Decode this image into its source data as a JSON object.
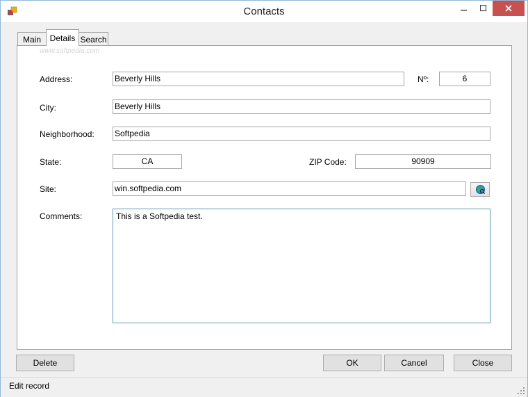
{
  "window": {
    "title": "Contacts"
  },
  "tabs": [
    {
      "label": "Main"
    },
    {
      "label": "Details"
    },
    {
      "label": "Search"
    }
  ],
  "watermark": "www.softpedia.com",
  "form": {
    "address_label": "Address:",
    "address_value": "Beverly Hills",
    "number_label": "Nº:",
    "number_value": "6",
    "city_label": "City:",
    "city_value": "Beverly Hills",
    "neighborhood_label": "Neighborhood:",
    "neighborhood_value": "Softpedia",
    "state_label": "State:",
    "state_value": "CA",
    "zip_label": "ZIP Code:",
    "zip_value": "90909",
    "site_label": "Site:",
    "site_value": "win.softpedia.com",
    "comments_label": "Comments:",
    "comments_value": "This is a Softpedia test."
  },
  "buttons": {
    "delete": "Delete",
    "ok": "OK",
    "cancel": "Cancel",
    "close": "Close"
  },
  "status": {
    "text": "Edit record"
  },
  "icons": {
    "app": "app-icon",
    "browse": "globe-icon",
    "minimize": "minimize-icon",
    "maximize": "maximize-icon",
    "close": "close-icon"
  },
  "colors": {
    "close_button": "#c75050",
    "memo_border": "#5a9ab8",
    "window_border": "#8fb7db"
  }
}
